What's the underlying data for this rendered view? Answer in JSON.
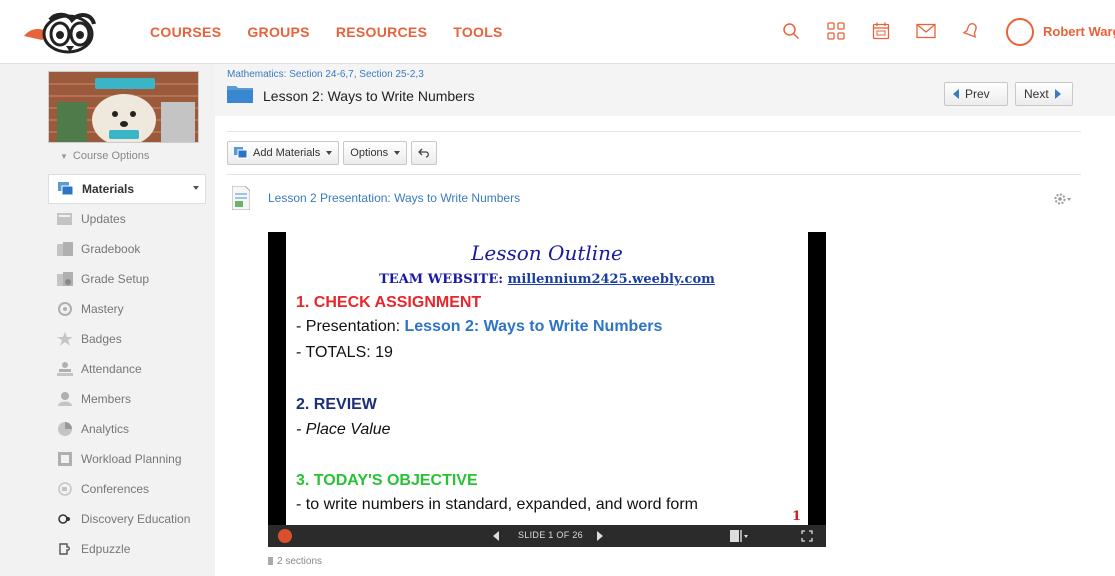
{
  "nav": {
    "links": [
      "COURSES",
      "GROUPS",
      "RESOURCES",
      "TOOLS"
    ],
    "user_name": "Robert Warg",
    "accent_color": "#e8623b",
    "icons": [
      "search-icon",
      "apps-grid-icon",
      "calendar-icon",
      "mail-icon",
      "notifications-icon"
    ]
  },
  "sidebar": {
    "course_options": "Course Options",
    "items": [
      {
        "label": "Materials",
        "icon": "materials-icon",
        "active": true
      },
      {
        "label": "Updates",
        "icon": "updates-icon"
      },
      {
        "label": "Gradebook",
        "icon": "gradebook-icon"
      },
      {
        "label": "Grade Setup",
        "icon": "grade-setup-icon"
      },
      {
        "label": "Mastery",
        "icon": "mastery-icon"
      },
      {
        "label": "Badges",
        "icon": "badges-icon"
      },
      {
        "label": "Attendance",
        "icon": "attendance-icon"
      },
      {
        "label": "Members",
        "icon": "members-icon"
      },
      {
        "label": "Analytics",
        "icon": "analytics-icon"
      },
      {
        "label": "Workload Planning",
        "icon": "workload-icon"
      },
      {
        "label": "Conferences",
        "icon": "conferences-icon"
      },
      {
        "label": "Discovery Education",
        "icon": "discovery-icon"
      },
      {
        "label": "Edpuzzle",
        "icon": "edpuzzle-icon"
      }
    ]
  },
  "main": {
    "breadcrumb": "Mathematics: Section 24-6,7, Section 25-2,3",
    "title": "Lesson 2: Ways to Write Numbers",
    "prev_label": "Prev",
    "next_label": "Next",
    "toolbar": {
      "add_materials": "Add Materials",
      "options": "Options"
    },
    "material_link": "Lesson 2 Presentation: Ways to Write Numbers",
    "sections": "2 sections"
  },
  "slide": {
    "title": "Lesson Outline",
    "website_label": "TEAM WEBSITE:",
    "website_url": "millennium2425.weebly.com",
    "h1": "1. CHECK ASSIGNMENT",
    "l1_prefix": "- Presentation: ",
    "l1_link": "Lesson 2: Ways to Write Numbers",
    "l2": "- TOTALS:  19",
    "h2": "2. REVIEW",
    "l3": "- Place Value",
    "h3": "3. TODAY'S OBJECTIVE",
    "l4": "-   to write numbers in standard, expanded, and word form",
    "slide_number": "1",
    "counter": "SLIDE 1 OF 26"
  }
}
